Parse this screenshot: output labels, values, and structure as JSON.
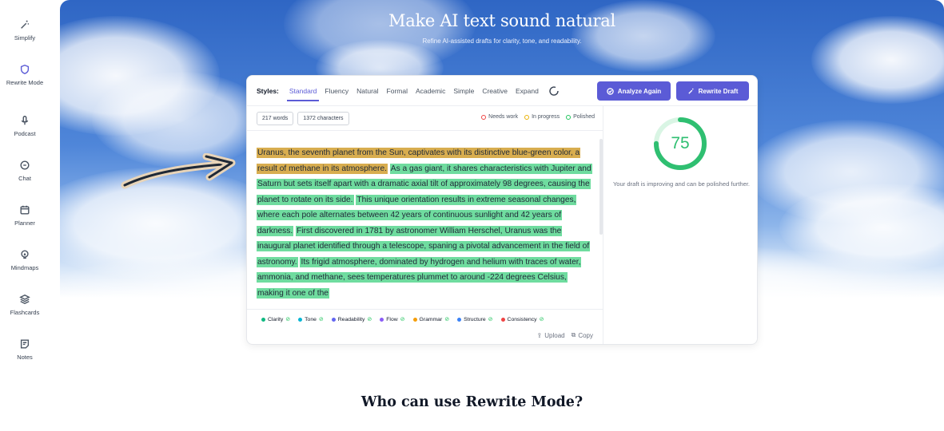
{
  "sidebar": {
    "items": [
      {
        "label": "Simplify",
        "icon": "magic-wand-icon"
      },
      {
        "label": "Rewrite Mode",
        "icon": "shield-icon"
      },
      {
        "label": "Podcast",
        "icon": "microphone-icon"
      },
      {
        "label": "Chat",
        "icon": "chat-bubble-icon"
      },
      {
        "label": "Planner",
        "icon": "calendar-icon"
      },
      {
        "label": "Mindmaps",
        "icon": "lightbulb-icon"
      },
      {
        "label": "Flashcards",
        "icon": "stack-icon"
      },
      {
        "label": "Notes",
        "icon": "note-icon"
      }
    ],
    "active": "Rewrite Mode"
  },
  "hero": {
    "title": "Make AI text sound natural",
    "subtitle": "Refine AI-assisted drafts for clarity, tone, and readability."
  },
  "editor": {
    "styles_label": "Styles:",
    "style_tabs": [
      "Standard",
      "Fluency",
      "Natural",
      "Formal",
      "Academic",
      "Simple",
      "Creative",
      "Expand"
    ],
    "active_style": "Standard",
    "analyze_button": "Analyze Again",
    "rewrite_button": "Rewrite Draft",
    "word_count": "217 words",
    "char_count": "1372 characters",
    "status_legend": [
      {
        "label": "Needs work",
        "color": "#ef4444"
      },
      {
        "label": "In progress",
        "color": "#eab308"
      },
      {
        "label": "Polished",
        "color": "#22c55e"
      }
    ],
    "text_segments": [
      {
        "text": "Uranus, the seventh planet from the Sun, captivates with its distinctive blue-green color, a result of methane in its atmosphere.",
        "status": "in-progress"
      },
      {
        "text": "As a gas giant, it shares characteristics with Jupiter and Saturn but sets itself apart with a dramatic axial tilt of approximately 98 degrees, causing the planet to rotate on its side.",
        "status": "polished"
      },
      {
        "text": "This unique orientation results in extreme seasonal changes, where each pole alternates between 42 years of continuous sunlight and 42 years of darkness.",
        "status": "polished"
      },
      {
        "text": "First discovered in 1781 by astronomer William Herschel, Uranus was the inaugural planet identified through a telescope, spaning a pivotal advancement in the field of astronomy.",
        "status": "polished"
      },
      {
        "text": "Its frigid atmosphere, dominated by hydrogen and helium with traces of water, ammonia, and methane, sees temperatures plummet to around -224 degrees Celsius, making it one of the",
        "status": "polished"
      }
    ],
    "metrics": [
      {
        "label": "Clarity",
        "color": "#10b981"
      },
      {
        "label": "Tone",
        "color": "#06b6d4"
      },
      {
        "label": "Readability",
        "color": "#6366f1"
      },
      {
        "label": "Flow",
        "color": "#8b5cf6"
      },
      {
        "label": "Grammar",
        "color": "#f59e0b"
      },
      {
        "label": "Structure",
        "color": "#3b82f6"
      },
      {
        "label": "Consistency",
        "color": "#ef4444"
      }
    ],
    "upload_label": "Upload",
    "copy_label": "Copy",
    "score": "75",
    "score_value": 0.75,
    "score_message": "Your draft is improving and can be polished further."
  },
  "section": {
    "title": "Who can use Rewrite Mode?"
  },
  "colors": {
    "accent": "#5b5bd6",
    "in_progress_highlight": "#d8ad4f",
    "polished_highlight": "#6fdc9f",
    "score": "#2fbf71"
  }
}
